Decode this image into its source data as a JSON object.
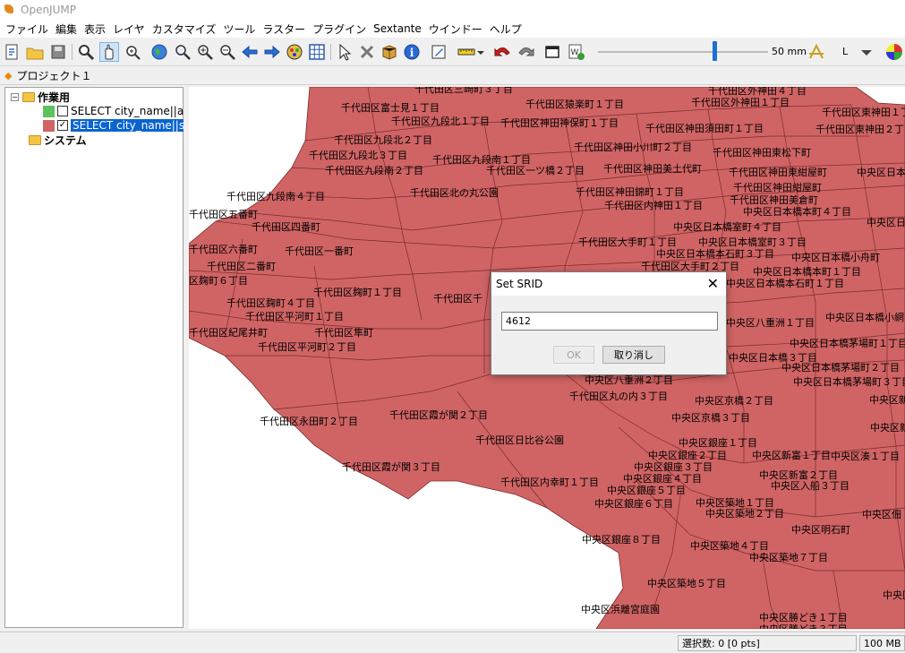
{
  "window": {
    "title": "OpenJUMP"
  },
  "menu": [
    "ファイル",
    "編集",
    "表示",
    "レイヤ",
    "カスタマイズ",
    "ツール",
    "ラスター",
    "プラグイン",
    "Sextante",
    "ウインドー",
    "ヘルプ"
  ],
  "toolbar": {
    "icons": [
      "new-project-icon",
      "open-folder-icon",
      "save-icon",
      "zoom-icon",
      "pan-hand-icon",
      "pan-zoom-icon",
      "globe-icon",
      "zoom-previous-icon",
      "zoom-in-icon",
      "zoom-out-icon",
      "back-arrow-icon",
      "forward-arrow-icon",
      "layer-style-icon",
      "grid-icon",
      "select-arrow-icon",
      "delete-feature-icon",
      "package-icon",
      "info-icon",
      "edit-icon",
      "measure-ruler-icon",
      "undo-icon",
      "redo-icon",
      "window-icon",
      "wms-icon",
      "compass-icon",
      "color-wheel-icon"
    ],
    "scale_label": "50 mm",
    "scale_letter": "L"
  },
  "project": {
    "tab_label": "プロジェクト１"
  },
  "layer_tree": {
    "category_work": "作業用",
    "layer1": "SELECT city_name||aza_c",
    "layer2": "SELECT city_name||s_na",
    "category_system": "システム",
    "colors": {
      "layer1": "#5cc35c",
      "layer2": "#d06464"
    }
  },
  "map": {
    "fill_color": "#d06464",
    "labels": [
      "千代田区三崎町３丁目",
      "千代田区富士見１丁目",
      "千代田区猿楽町１丁目",
      "千代田区外神田４丁目",
      "千代田区外神田１丁目",
      "千代田区東神田１丁目",
      "千代田区九段北１丁目",
      "千代田区神田神保町１丁目",
      "千代田区神田須田町１丁目",
      "千代田区東神田２丁目",
      "千代田区九段北２丁目",
      "千代田区神田小川町２丁目",
      "千代田区神田東松下町",
      "千代田区九段北３丁目",
      "千代田区九段南１丁目",
      "千代田区九段南２丁目",
      "千代田区一ツ橋２丁目",
      "千代田区神田美土代町",
      "千代田区神田東紺屋町",
      "中央区日本橋",
      "千代田区九段南４丁目",
      "千代田区北の丸公園",
      "千代田区神田錦町１丁目",
      "千代田区神田紺屋町",
      "千代田区神田美倉町",
      "千代田区五番町",
      "千代田区内神田１丁目",
      "中央区日本橋本町４丁目",
      "千代田区四番町",
      "中央区日本橋室町４丁目",
      "中央区日本",
      "千代田区六番町",
      "千代田区一番町",
      "千代田区大手町１丁目",
      "中央区日本橋室町３丁目",
      "中央区日本橋本石町３丁目",
      "中央区日本橋小舟町",
      "千代田区二番町",
      "千代田区大手町２丁目",
      "中央区日本橋本町１丁目",
      "区麹町６丁目",
      "中央区日本橋本石町１丁目",
      "千代田区麹町１丁目",
      "千代田区麹町４丁目",
      "千代田区千",
      "千代田区平河町１丁目",
      "中央区日本橋小網",
      "千代田区紀尾井町",
      "千代田区隼町",
      "中央区八重洲１丁目",
      "千代田区平河町２丁目",
      "中央区日本橋茅場町１丁目",
      "中央区日本橋３丁目",
      "中央区日本橋茅場町２丁目",
      "中央区八重洲２丁目",
      "中央区日本橋茅場町３丁目",
      "千代田区丸の内３丁目",
      "中央区京橋２丁目",
      "中央区新",
      "千代田区永田町２丁目",
      "千代田区霞が関２丁目",
      "中央区京橋３丁目",
      "中央区新川２",
      "千代田区日比谷公園",
      "中央区銀座１丁目",
      "中央区銀座２丁目",
      "中央区新富１丁目",
      "中央区湊１丁目",
      "中央区銀座３丁目",
      "千代田区霞が関３丁目",
      "中央区新富２丁目",
      "千代田区内幸町１丁目",
      "中央区銀座４丁目",
      "中央区入船３丁目",
      "中央区銀座５丁目",
      "中央区築地１丁目",
      "中央区銀座６丁目",
      "中央区築地２丁目",
      "中央区佃",
      "中央区明石町",
      "中央区銀座８丁目",
      "中央区築地４丁目",
      "中央区築地７丁目",
      "中央区築地５丁目",
      "中央区月",
      "中央区浜離宮庭園",
      "中央区勝どき１丁目",
      "中央区勝どき３丁目"
    ]
  },
  "status": {
    "selection": "選択数: 0 [0 pts]",
    "memory": "100 MB ("
  },
  "dialog": {
    "title": "Set SRID",
    "input_value": "4612",
    "ok_label": "OK",
    "cancel_label": "取り消し"
  }
}
